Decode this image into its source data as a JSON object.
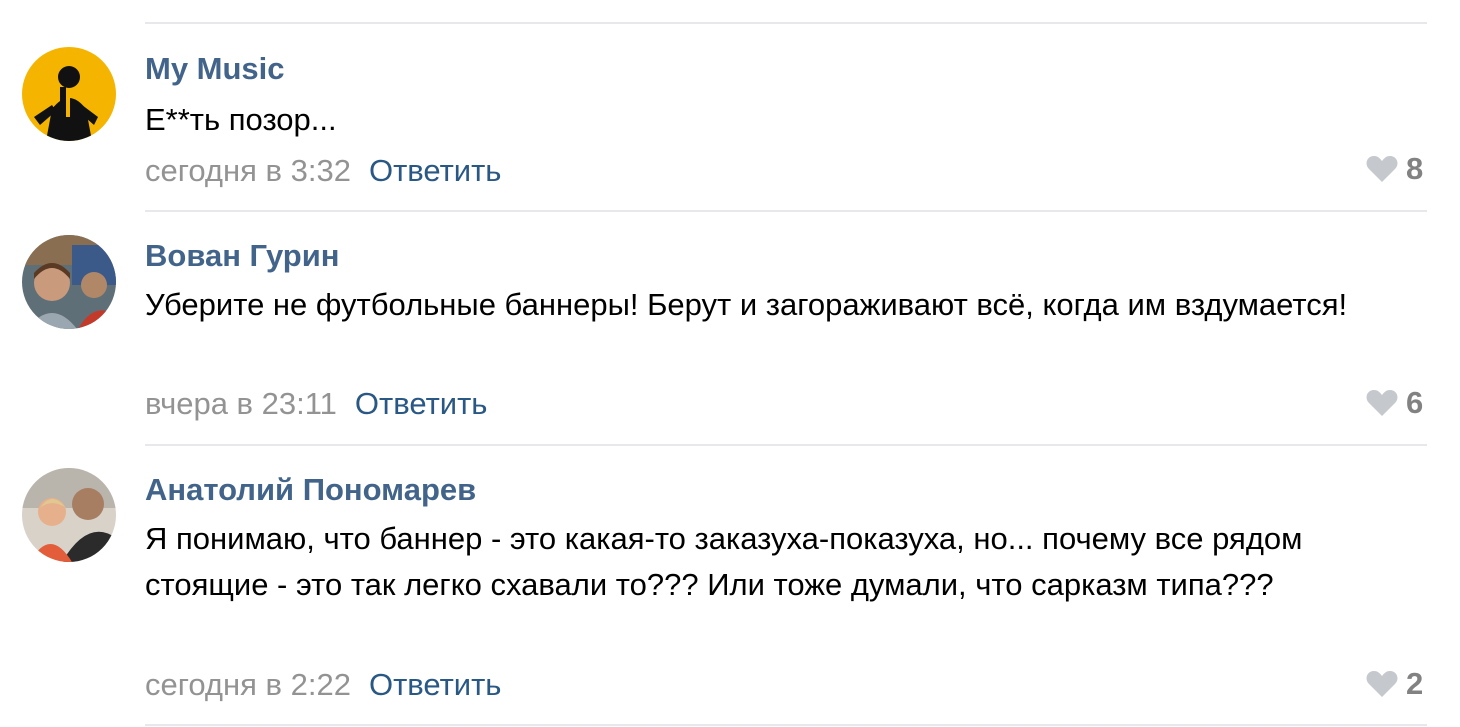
{
  "comments": [
    {
      "author": "My Music",
      "text": "Е**ть позор...",
      "time": "сегодня в 3:32",
      "reply_label": "Ответить",
      "likes": "8",
      "avatar_icon": "musician-silhouette-icon"
    },
    {
      "author": "Вован Гурин",
      "text": "Уберите не футбольные баннеры! Берут и загораживают всё, когда им вздумается!",
      "time": "вчера в 23:11",
      "reply_label": "Ответить",
      "likes": "6",
      "avatar_icon": "user-photo-avatar"
    },
    {
      "author": "Анатолий Пономарев",
      "text": "Я понимаю, что баннер - это какая-то заказуха-показуха, но... почему все рядом стоящие - это так легко схавали то??? Или тоже думали, что сарказм типа???",
      "time": "сегодня в 2:22",
      "reply_label": "Ответить",
      "likes": "2",
      "avatar_icon": "user-photo-avatar"
    }
  ],
  "colors": {
    "author": "#42648b",
    "reply": "#2a5885",
    "time": "#939393",
    "divider": "#e7e8ec",
    "like_icon": "#c5c8cc"
  }
}
